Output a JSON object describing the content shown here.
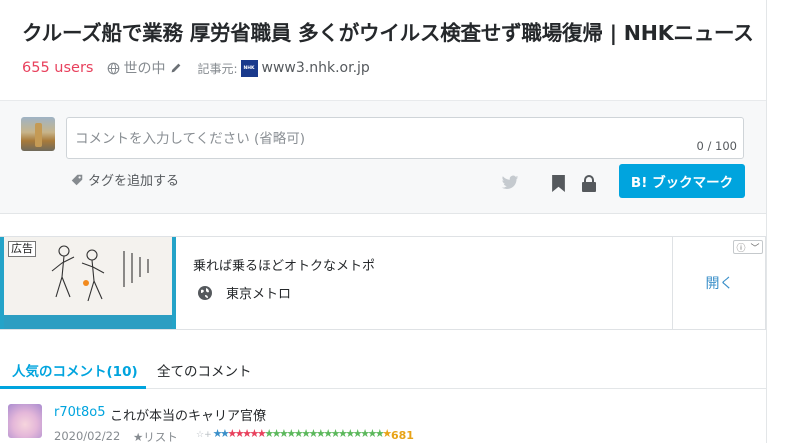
{
  "entry": {
    "title": "クルーズ船で業務 厚労省職員 多くがウイルス検査せず職場復帰 | NHKニュース",
    "users": "655 users",
    "category": "世の中",
    "source_label": "記事元:",
    "favicon_text": "NHK",
    "domain": "www3.nhk.or.jp"
  },
  "comment_form": {
    "placeholder": "コメントを入力してください (省略可)",
    "counter": "0 / 100",
    "add_tag": "タグを追加する",
    "bookmark_button": "B! ブックマーク"
  },
  "ad": {
    "label": "広告",
    "title": "乗れば乗るほどオトクなメトポ",
    "advertiser": "東京メトロ",
    "open": "開く",
    "info": "ⓘ",
    "chevron": "﹀"
  },
  "tabs": [
    {
      "label": "人気のコメント(10)",
      "active": true
    },
    {
      "label": "全てのコメント",
      "active": false
    }
  ],
  "comments": [
    {
      "user": "r70t8o5",
      "text": "これが本当のキャリア官僚",
      "date": "2020/02/22",
      "list": "★リスト",
      "star_count": "681"
    }
  ],
  "colors": {
    "accent": "#00a4de",
    "users": "#e8415d",
    "star_green": "#5cb85c",
    "star_red": "#e8415d",
    "star_blue": "#3a8fc9",
    "star_yellow": "#e8a317"
  }
}
